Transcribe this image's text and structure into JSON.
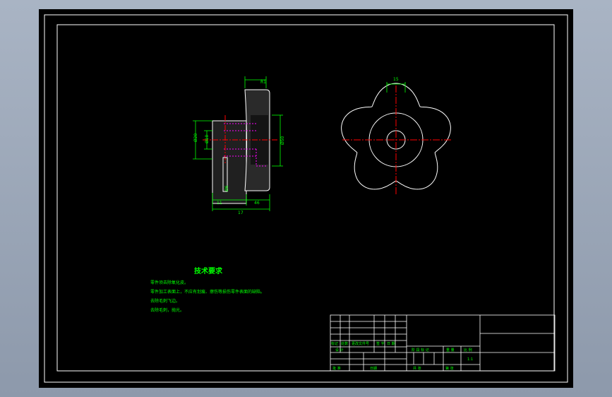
{
  "colors": {
    "background": "#000000",
    "outline": "#ffffff",
    "dimension": "#00ff00",
    "centerline": "#ff0000",
    "hidden": "#ff00ff"
  },
  "front_view": {
    "dim_top": "R1",
    "dim_left_outer": "Ø20",
    "dim_left_inner": "Ø10",
    "dim_right": "Ø50",
    "dim_pin": "Ø6",
    "dim_bottom_left": "11",
    "dim_bottom_right": "46",
    "dim_total": "17"
  },
  "side_view": {
    "dim_top": "15"
  },
  "technical_requirements": {
    "title": "技术要求",
    "items": [
      "零件须去除氧化皮。",
      "零件加工表面上，不应有划痕、擦伤等损伤零件表面的缺陷。",
      "去除毛刺飞边。",
      "去除毛刺，抛光。"
    ]
  },
  "title_block": {
    "row_labels": [
      "标记",
      "处数",
      "更改文件号",
      "签 字",
      "日 期"
    ],
    "design_label": "设 计",
    "approve_label": "批 准",
    "date_label": "日期",
    "stage_label": "阶 段 标 记",
    "weight_label": "重 量",
    "scale_label": "比 例",
    "scale_value": "1:1",
    "sheets_label": "共    张",
    "sheet_label": "第    张"
  }
}
